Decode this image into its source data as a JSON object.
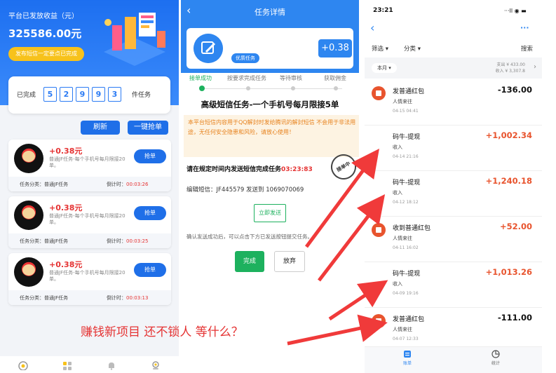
{
  "left": {
    "hero_title": "平台已发放收益（元）",
    "hero_amount": "325586.00元",
    "hero_pill": "发布短信一定要点已完成",
    "done_label": "已完成",
    "done_digits": [
      "5",
      "2",
      "9",
      "9",
      "3"
    ],
    "done_suffix": "件任务",
    "refresh_label": "刷新",
    "grab_all_label": "一键抢单",
    "tasks": [
      {
        "price": "+0.38元",
        "desc": "普通JF任务-每个手机号每月限接20单。",
        "grab": "抢单",
        "category": "任务分类：普通JF任务",
        "countdown_label": "倒计时：",
        "countdown": "00:03:26"
      },
      {
        "price": "+0.38元",
        "desc": "普通JF任务-每个手机号每月限接20单。",
        "grab": "抢单",
        "category": "任务分类：普通JF任务",
        "countdown_label": "倒计时：",
        "countdown": "00:03:25"
      },
      {
        "price": "+0.38元",
        "desc": "普通JF任务-每个手机号每月限接20单。",
        "grab": "抢单",
        "category": "任务分类：普通JF任务",
        "countdown_label": "倒计时：",
        "countdown": "00:03:13"
      }
    ],
    "tab_icons": [
      "home-icon",
      "grid-icon",
      "bell-icon",
      "user-icon"
    ]
  },
  "middle": {
    "title": "任务详情",
    "badge": "优质任务",
    "amount": "+0.38",
    "steps": [
      "接单成功",
      "按要求完成任务",
      "等待审核",
      "获取佣金"
    ],
    "task_title": "高级短信任务-一个手机号每月限接5单",
    "warning": "本平台短信内容用于QQ解封时发给腾讯的解封短信 不会用于非法用途，无任何安全隐患和风险，请放心使用！",
    "stamp": "接单中",
    "instruction": "请在规定时间内发送短信完成任务",
    "instruction_time": "03:23:83",
    "sms_line": "编辑短信：JF445579 发送到 1069070069",
    "send_label": "立即发送",
    "note": "确认发送成功后，可以点击下方已发送按钮提交任务。",
    "done_label": "完成",
    "quit_label": "放弃"
  },
  "right": {
    "time": "23:21",
    "signal": "···ll ◉ ▬",
    "more": "···",
    "filter1": "筛选",
    "filter2": "分类",
    "search": "搜索",
    "month": "本月",
    "expense": "支出 ¥ 433.00",
    "income": "收入 ¥ 3,307.8",
    "rows": [
      {
        "name": "发普通红包",
        "sub": "人情来往",
        "date": "04-15 04:41",
        "amount": "-136.00",
        "sign": "neg",
        "icon": "red-envelope-icon"
      },
      {
        "name": "码牛-提现",
        "sub": "收入",
        "date": "04-14 21:16",
        "amount": "+1,002.34",
        "sign": "pos",
        "icon": ""
      },
      {
        "name": "码牛-提现",
        "sub": "收入",
        "date": "04-12 18:12",
        "amount": "+1,240.18",
        "sign": "pos",
        "icon": ""
      },
      {
        "name": "收到普通红包",
        "sub": "人情来往",
        "date": "04-11 16:02",
        "amount": "+52.00",
        "sign": "pos",
        "icon": "red-envelope-icon"
      },
      {
        "name": "码牛-提现",
        "sub": "收入",
        "date": "04-09 19:16",
        "amount": "+1,013.26",
        "sign": "pos",
        "icon": ""
      },
      {
        "name": "发普通红包",
        "sub": "人情来往",
        "date": "04-07 12:33",
        "amount": "-111.00",
        "sign": "neg",
        "icon": "red-envelope-icon"
      }
    ],
    "tab_bill": "账单",
    "tab_stats": "统计"
  },
  "caption": "赚钱新项目 还不锁人 等什么？",
  "colors": {
    "primary": "#1f6fe8",
    "green": "#1db15e",
    "red": "#e53333",
    "orange": "#e8542e",
    "yellow": "#f7c21b"
  }
}
